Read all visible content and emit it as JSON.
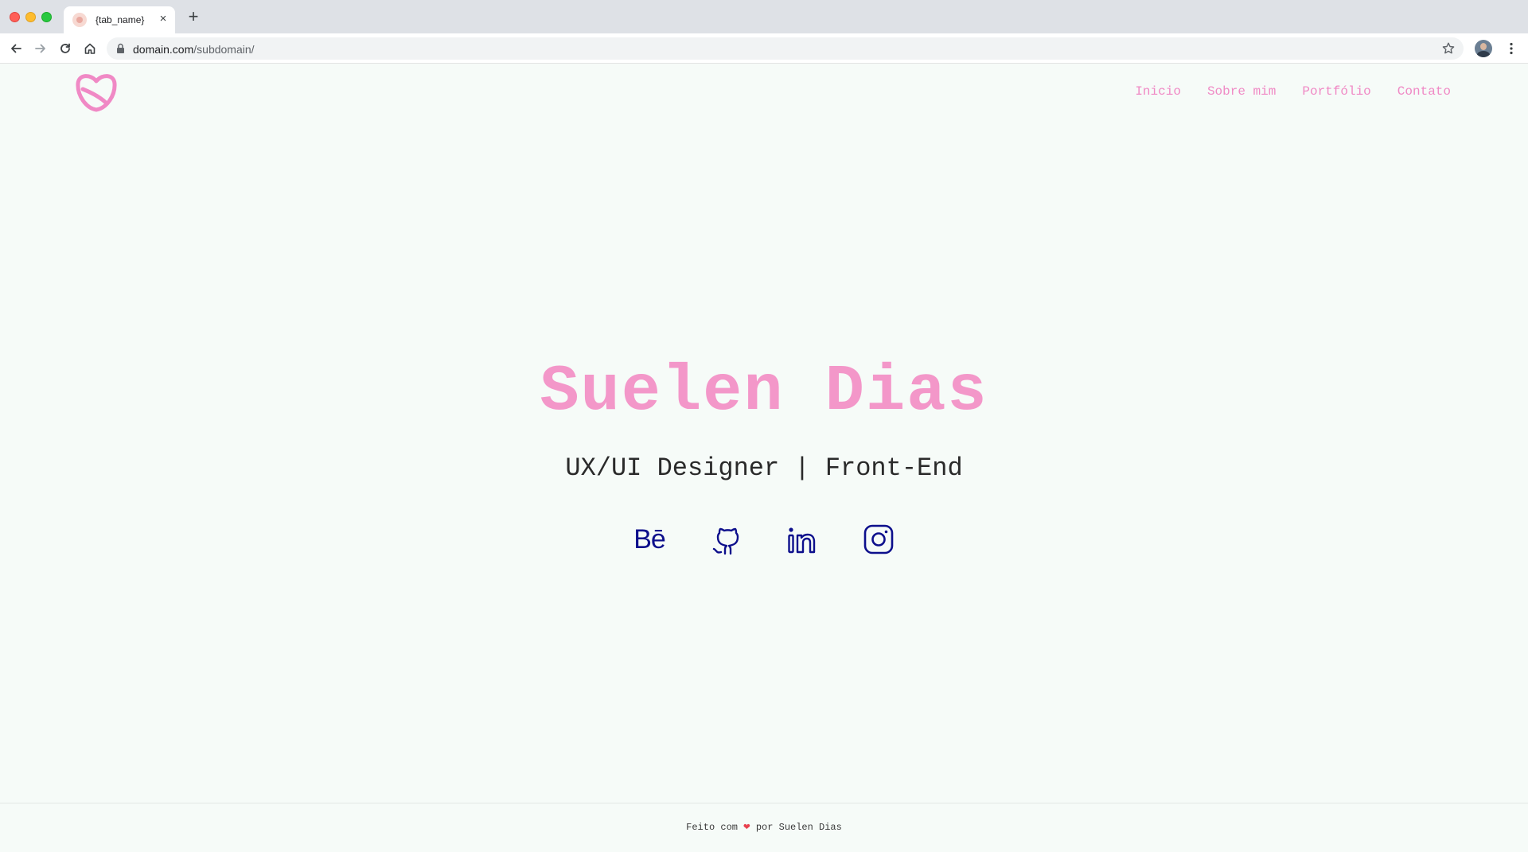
{
  "browser": {
    "tab_title": "{tab_name}",
    "url_domain": "domain.com",
    "url_path": "/subdomain/"
  },
  "nav": {
    "items": [
      "Inicio",
      "Sobre mim",
      "Portfólio",
      "Contato"
    ]
  },
  "hero": {
    "name": "Suelen Dias",
    "role": "UX/UI Designer | Front-End"
  },
  "socials": [
    {
      "name": "behance",
      "icon": "behance-icon",
      "text": "Bē"
    },
    {
      "name": "github",
      "icon": "github-icon"
    },
    {
      "name": "linkedin",
      "icon": "linkedin-icon"
    },
    {
      "name": "instagram",
      "icon": "instagram-icon"
    }
  ],
  "footer": {
    "before": "Feito com",
    "heart": "❤",
    "after": "por Suelen Dias"
  },
  "colors": {
    "accent_pink": "#f397c9",
    "nav_pink": "#f089c5",
    "icon_navy": "#0d0f8c",
    "page_bg": "#f6fbf8"
  }
}
